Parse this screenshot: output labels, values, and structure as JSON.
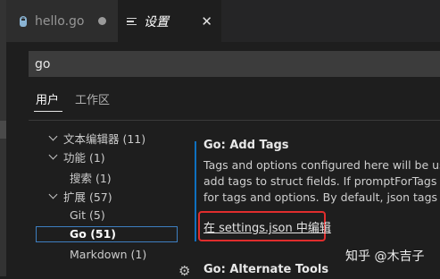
{
  "tabs": [
    {
      "label": "hello.go",
      "icon": "go-file-icon",
      "state": "unsaved"
    },
    {
      "label": "设置",
      "icon": "settings-editor-icon",
      "active": true
    }
  ],
  "search": {
    "value": "go"
  },
  "scopes": [
    "用户",
    "工作区"
  ],
  "tree": {
    "items": [
      {
        "label": "文本编辑器 (11)"
      },
      {
        "label": "功能 (1)"
      },
      {
        "label": "搜索 (1)"
      },
      {
        "label": "扩展 (57)"
      },
      {
        "label": "Git (5)"
      },
      {
        "label": "Go (51)"
      },
      {
        "label": "Markdown (1)"
      }
    ]
  },
  "setting": {
    "title": "Go: Add Tags",
    "description_lines": [
      "Tags and options configured here will be use",
      "add tags to struct fields. If promptForTags is",
      "for tags and options. By default, json tags ar"
    ],
    "edit_link": "在 settings.json 中编辑"
  },
  "next_setting": {
    "title": "Go: Alternate Tools"
  },
  "watermark": "知乎 @木吉子",
  "colors": {
    "accent": "#0e70c0",
    "highlight_box": "#e02d2d",
    "selection_border": "#3e7fc1"
  }
}
